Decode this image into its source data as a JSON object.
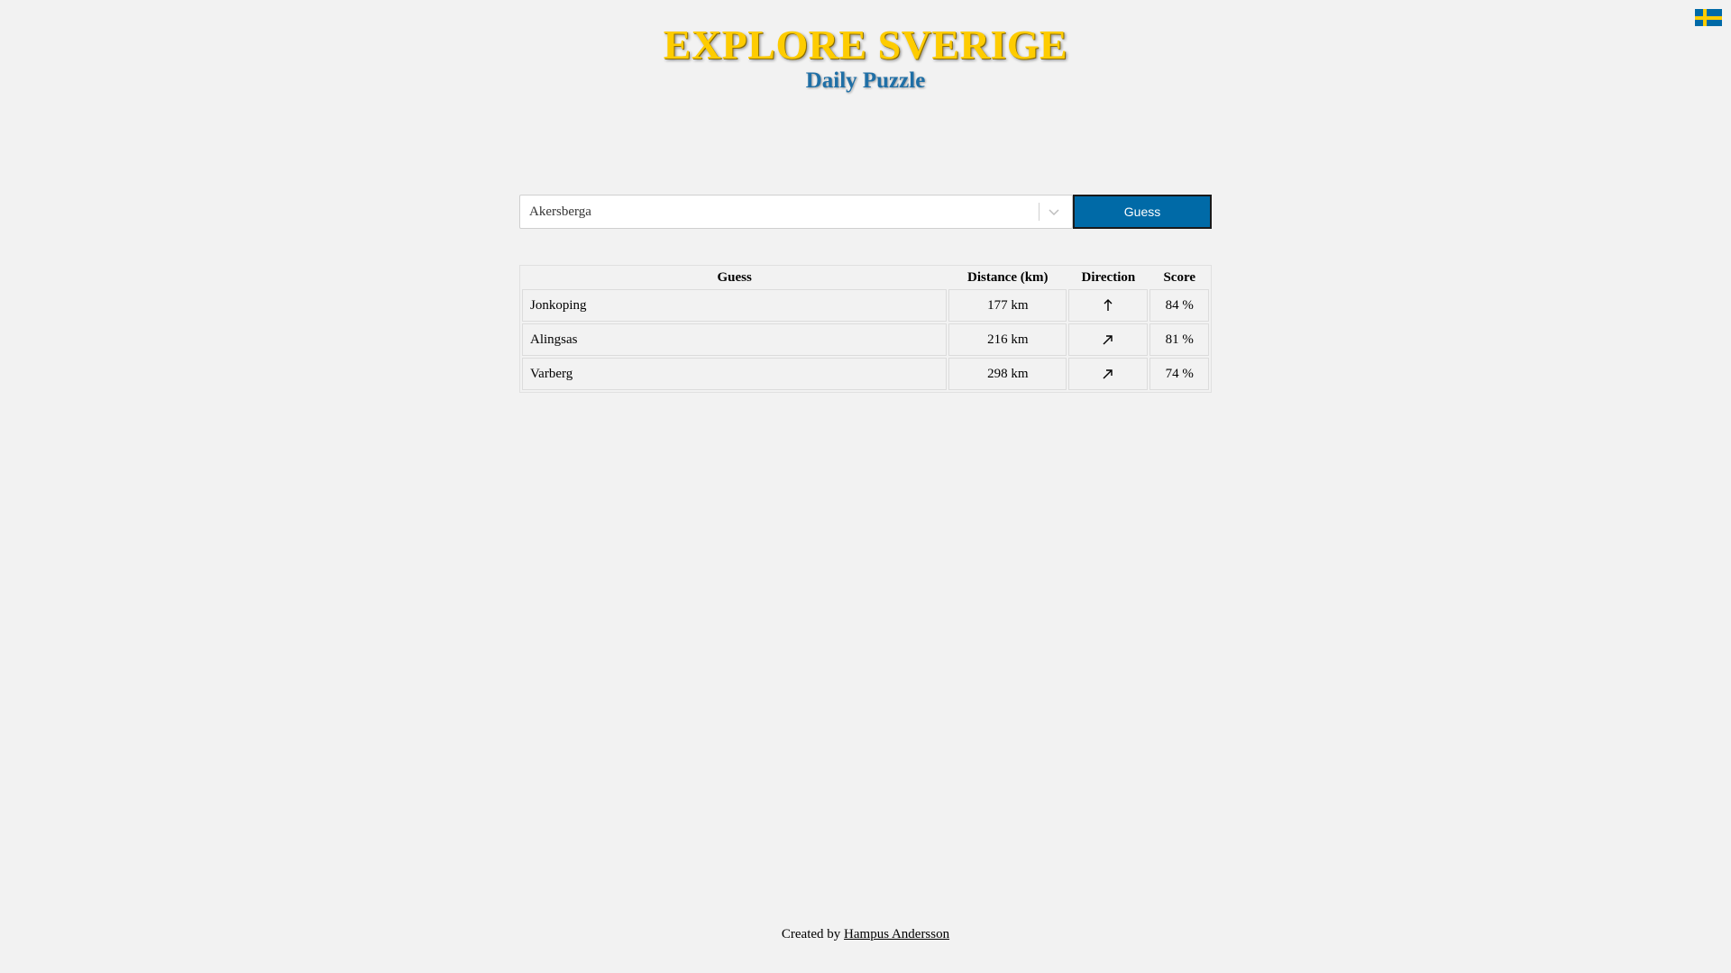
{
  "header": {
    "title": "EXPLORE SVERIGE",
    "subtitle": "Daily Puzzle"
  },
  "language": {
    "icon": "sweden-flag-icon",
    "flag_colors": {
      "blue": "#006aa7",
      "yellow": "#fecc00"
    }
  },
  "search": {
    "selected_value": "Akersberga",
    "chevron_icon": "chevron-down-icon",
    "button_label": "Guess",
    "button_color": "#006aa7"
  },
  "table": {
    "columns": [
      "Guess",
      "Distance (km)",
      "Direction",
      "Score"
    ],
    "rows": [
      {
        "guess": "Jonkoping",
        "distance": "177 km",
        "direction": "north",
        "direction_glyph": "↑",
        "score": "84 %"
      },
      {
        "guess": "Alingsas",
        "distance": "216 km",
        "direction": "northeast",
        "direction_glyph": "↗",
        "score": "81 %"
      },
      {
        "guess": "Varberg",
        "distance": "298 km",
        "direction": "northeast",
        "direction_glyph": "↗",
        "score": "74 %"
      }
    ]
  },
  "footer": {
    "prefix": "Created by",
    "author": "Hampus Andersson"
  }
}
